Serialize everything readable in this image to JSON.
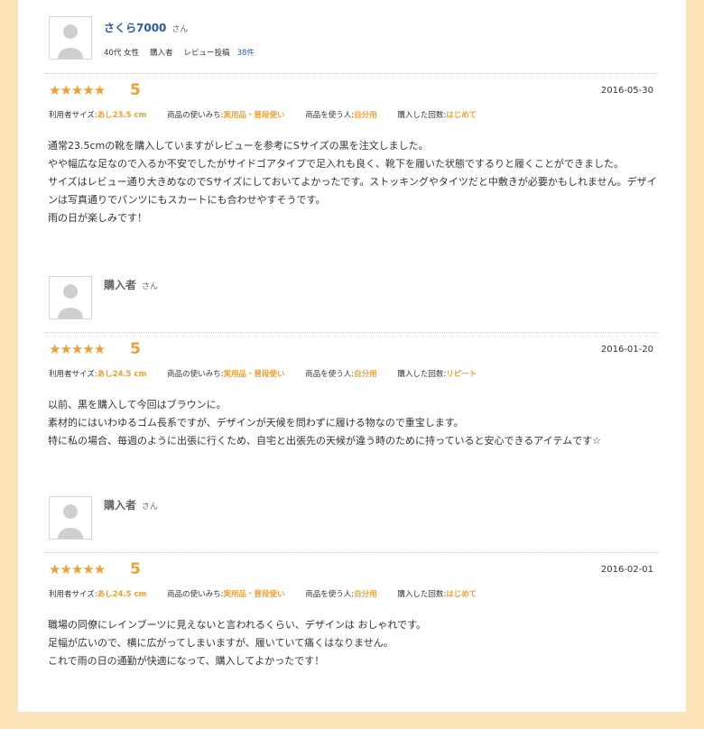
{
  "reviews": [
    {
      "reviewer": "さくら7000",
      "reviewer_is_link": true,
      "suffix": "さん",
      "meta": {
        "age_gender": "40代 女性",
        "buyer": "購入者",
        "posts_label": "レビュー投稿",
        "posts_count": "38件"
      },
      "stars": "★★★★★",
      "score": "5",
      "date": "2016-05-30",
      "attrs": [
        {
          "label": "利用者サイズ:",
          "value": "あし23.5 cm"
        },
        {
          "label": "商品の使いみち:",
          "value": "実用品・普段使い"
        },
        {
          "label": "商品を使う人:",
          "value": "自分用"
        },
        {
          "label": "購入した回数:",
          "value": "はじめて"
        }
      ],
      "body": [
        "通常23.5cmの靴を購入していますがレビューを参考にSサイズの黒を注文しました。",
        "やや幅広な足なので入るか不安でしたがサイドゴアタイプで足入れも良く、靴下を履いた状態でするりと履くことができました。",
        "サイズはレビュー通り大きめなのでSサイズにしておいてよかったです。ストッキングやタイツだと中敷きが必要かもしれません。デザインは写真通りでパンツにもスカートにも合わせやすそうです。",
        "雨の日が楽しみです！"
      ]
    },
    {
      "reviewer": "購入者",
      "reviewer_is_link": false,
      "suffix": "さん",
      "stars": "★★★★★",
      "score": "5",
      "date": "2016-01-20",
      "attrs": [
        {
          "label": "利用者サイズ:",
          "value": "あし24.5 cm"
        },
        {
          "label": "商品の使いみち:",
          "value": "実用品・普段使い"
        },
        {
          "label": "商品を使う人:",
          "value": "自分用"
        },
        {
          "label": "購入した回数:",
          "value": "リピート"
        }
      ],
      "body": [
        "以前、黒を購入して今回はブラウンに。",
        "素材的にはいわゆるゴム長系ですが、デザインが天候を問わずに履ける物なので重宝します。",
        "特に私の場合、毎週のように出張に行くため、自宅と出張先の天候が違う時のために持っていると安心できるアイテムです☆"
      ]
    },
    {
      "reviewer": "購入者",
      "reviewer_is_link": false,
      "suffix": "さん",
      "stars": "★★★★★",
      "score": "5",
      "date": "2016-02-01",
      "attrs": [
        {
          "label": "利用者サイズ:",
          "value": "あし24.5 cm"
        },
        {
          "label": "商品の使いみち:",
          "value": "実用品・普段使い"
        },
        {
          "label": "商品を使う人:",
          "value": "自分用"
        },
        {
          "label": "購入した回数:",
          "value": "はじめて"
        }
      ],
      "body": [
        "職場の同僚にレインブーツに見えないと言われるくらい、デザインは おしゃれです。",
        "足幅が広いので、横に広がってしまいますが、履いていて痛くはなりません。",
        "これで雨の日の通勤が快適になって、購入してよかったです！"
      ]
    }
  ],
  "colors": {
    "page_bg": "#fde3b8",
    "accent": "#f0a030",
    "link": "#2a5aa8"
  }
}
